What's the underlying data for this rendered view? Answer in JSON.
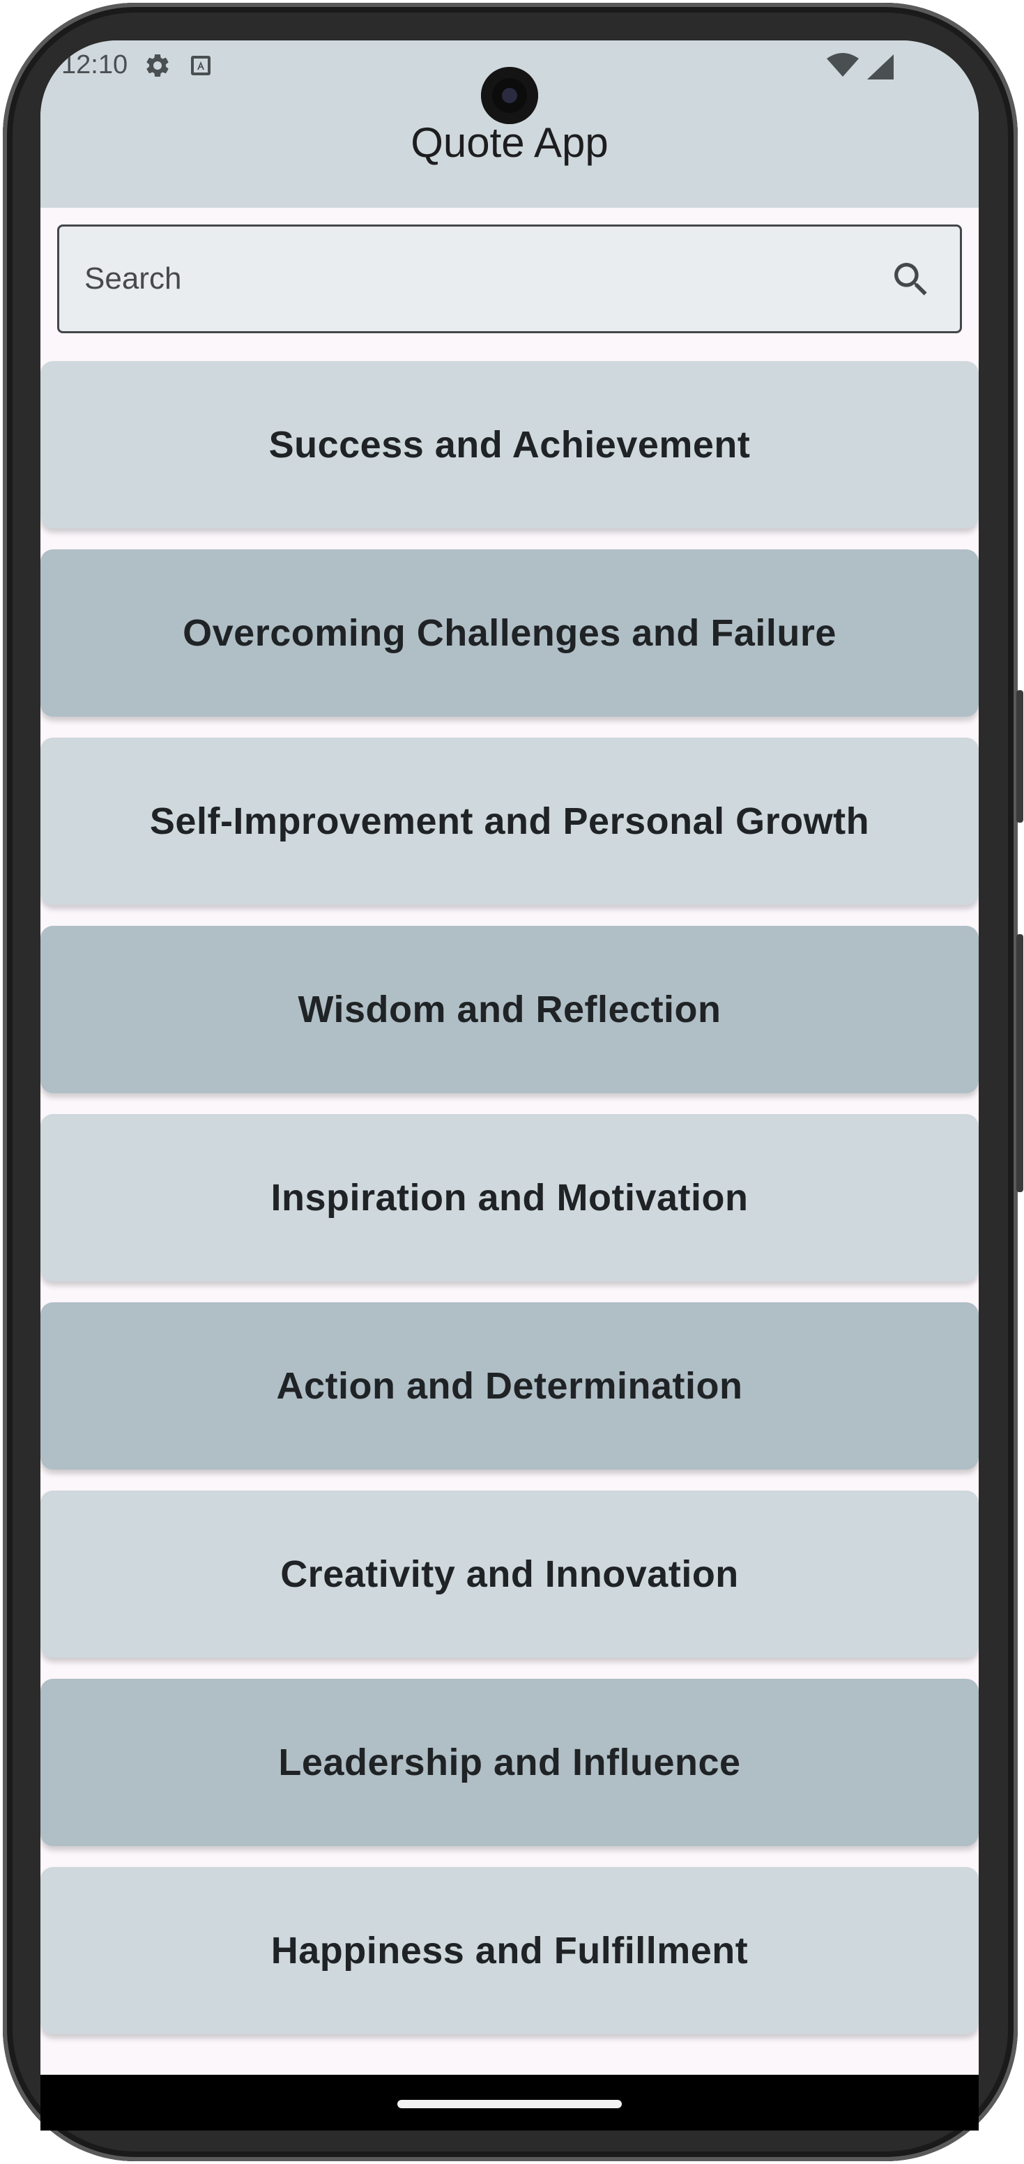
{
  "status_bar": {
    "time": "12:10"
  },
  "app_bar": {
    "title": "Quote App"
  },
  "search": {
    "placeholder": "Search"
  },
  "colors": {
    "app_bar": "#cfd8dc",
    "card_light": "#cfd8dc",
    "card_dark": "#b0bec5",
    "background": "#fcf7fb"
  },
  "categories": [
    {
      "label": "Success and Achievement"
    },
    {
      "label": "Overcoming Challenges and Failure"
    },
    {
      "label": "Self-Improvement and Personal Growth"
    },
    {
      "label": "Wisdom and Reflection"
    },
    {
      "label": "Inspiration and Motivation"
    },
    {
      "label": "Action and Determination"
    },
    {
      "label": "Creativity and Innovation"
    },
    {
      "label": "Leadership and Influence"
    },
    {
      "label": "Happiness and Fulfillment"
    }
  ]
}
